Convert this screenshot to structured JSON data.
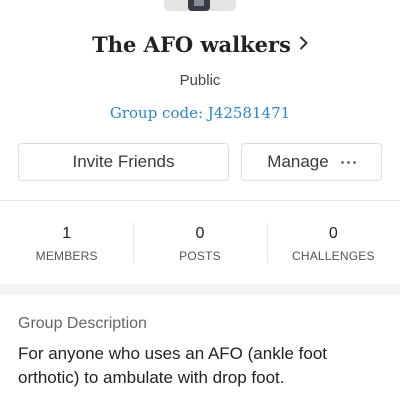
{
  "group": {
    "name": "The AFO walkers",
    "privacy": "Public",
    "code_text": "Group code: J42581471"
  },
  "actions": {
    "invite_label": "Invite Friends",
    "manage_label": "Manage"
  },
  "stats": [
    {
      "value": "1",
      "label": "MEMBERS"
    },
    {
      "value": "0",
      "label": "POSTS"
    },
    {
      "value": "0",
      "label": "CHALLENGES"
    }
  ],
  "description": {
    "heading": "Group Description",
    "body": "For anyone who uses an AFO (ankle foot orthotic) to ambulate with drop foot."
  },
  "colors": {
    "link": "#2d86c6",
    "text": "#222222",
    "divider": "#e8e8e8"
  },
  "icons": [
    "chevron-right-icon",
    "more-dots-icon"
  ]
}
